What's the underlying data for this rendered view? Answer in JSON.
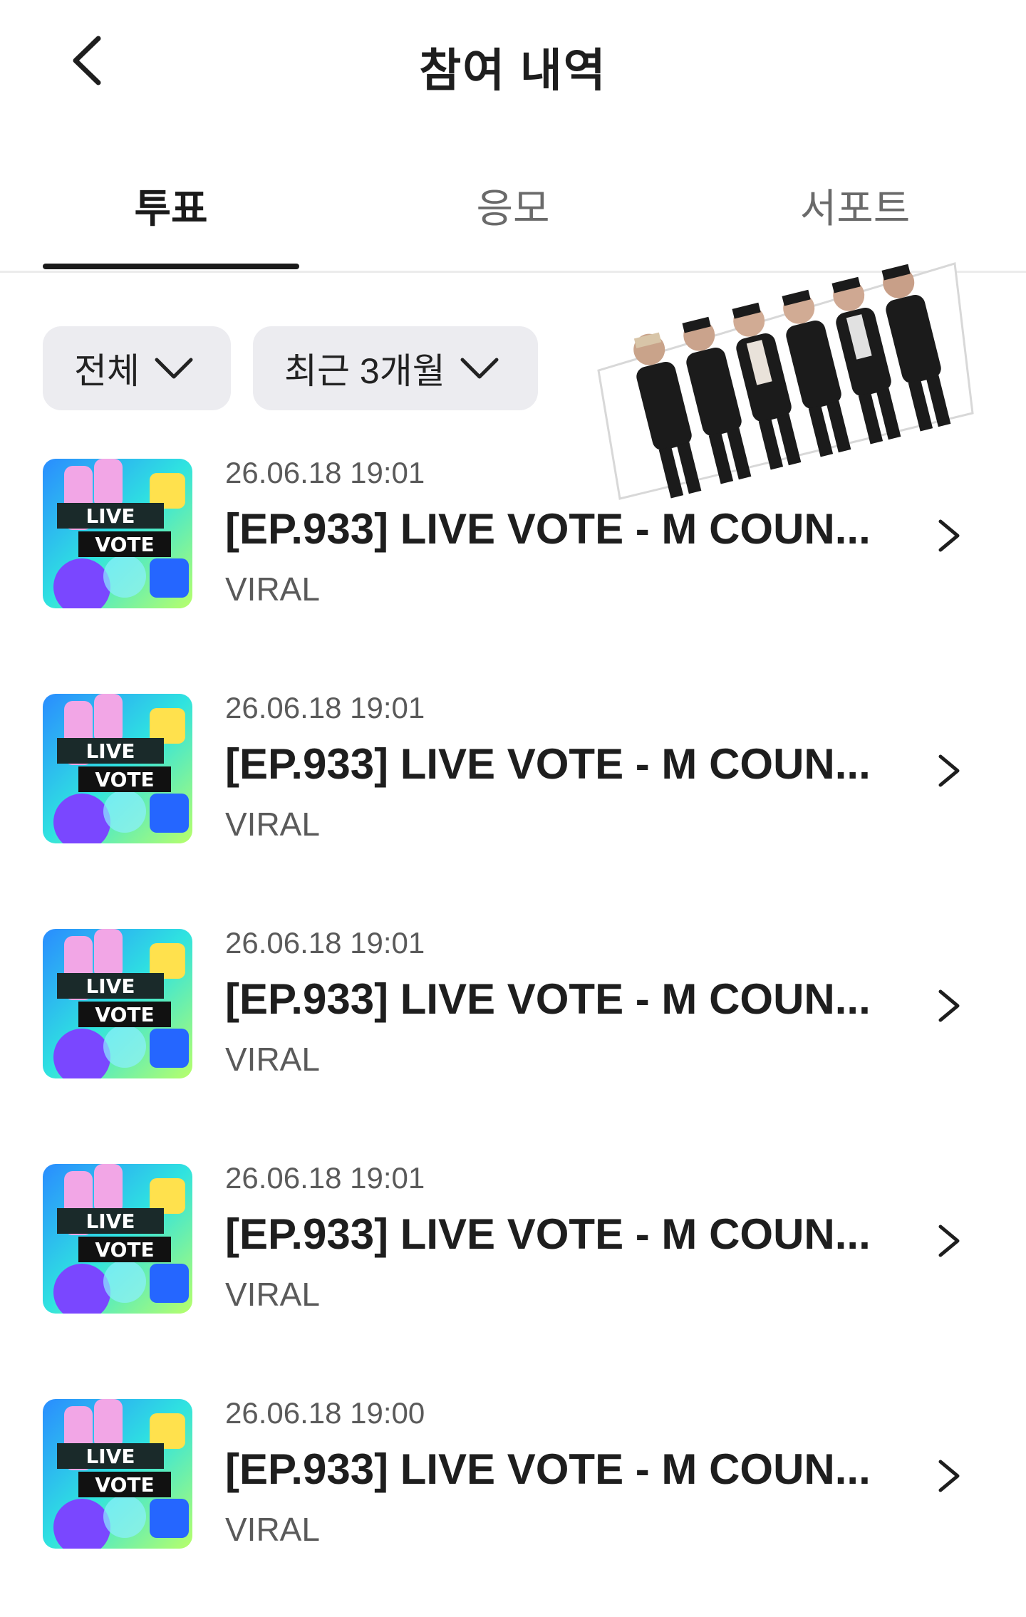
{
  "header": {
    "title": "참여 내역",
    "back_icon": "chevron-left-icon"
  },
  "tabs": [
    {
      "label": "투표",
      "active": true
    },
    {
      "label": "응모",
      "active": false
    },
    {
      "label": "서포트",
      "active": false
    }
  ],
  "filters": [
    {
      "label": "전체",
      "icon": "chevron-down-icon"
    },
    {
      "label": "최근 3개월",
      "icon": "chevron-down-icon"
    }
  ],
  "items": [
    {
      "date": "26.06.18 19:01",
      "title": "[EP.933] LIVE VOTE - M COUN...",
      "org": "VIRAL",
      "thumb_text": [
        "LIVE",
        "VOTE"
      ]
    },
    {
      "date": "26.06.18 19:01",
      "title": "[EP.933] LIVE VOTE - M COUN...",
      "org": "VIRAL",
      "thumb_text": [
        "LIVE",
        "VOTE"
      ]
    },
    {
      "date": "26.06.18 19:01",
      "title": "[EP.933] LIVE VOTE - M COUN...",
      "org": "VIRAL",
      "thumb_text": [
        "LIVE",
        "VOTE"
      ]
    },
    {
      "date": "26.06.18 19:01",
      "title": "[EP.933] LIVE VOTE - M COUN...",
      "org": "VIRAL",
      "thumb_text": [
        "LIVE",
        "VOTE"
      ]
    },
    {
      "date": "26.06.18 19:00",
      "title": "[EP.933] LIVE VOTE - M COUN...",
      "org": "VIRAL",
      "thumb_text": [
        "LIVE",
        "VOTE"
      ]
    }
  ],
  "colors": {
    "accent": "#1a1a1a",
    "chip_bg": "#ececf0",
    "muted": "#5a5a5a"
  }
}
